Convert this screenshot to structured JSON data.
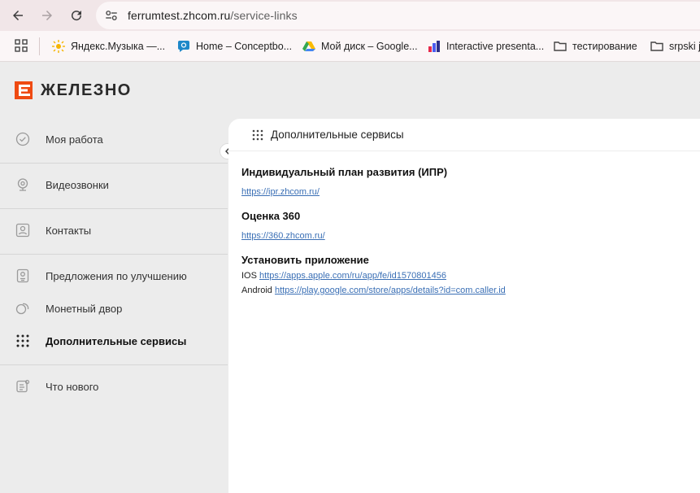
{
  "browser": {
    "url_host": "ferrumtest.zhcom.ru",
    "url_path": "/service-links",
    "bookmarks": [
      {
        "label": "Яндекс.Музыка —..."
      },
      {
        "label": "Home – Conceptbo..."
      },
      {
        "label": "Мой диск – Google..."
      },
      {
        "label": "Interactive presenta..."
      },
      {
        "label": "тестирование"
      },
      {
        "label": "srpski j"
      }
    ]
  },
  "app": {
    "logo_text": "ЖЕЛЕЗНО",
    "brand_color": "#ef4a12",
    "sidebar": {
      "items": [
        {
          "label": "Моя работа",
          "icon": "check-circle-icon"
        },
        {
          "label": "Видеозвонки",
          "icon": "webcam-icon"
        },
        {
          "label": "Контакты",
          "icon": "contact-card-icon"
        },
        {
          "label": "Предложения по улучшению",
          "icon": "suggestion-icon"
        },
        {
          "label": "Монетный двор",
          "icon": "coins-icon"
        },
        {
          "label": "Дополнительные сервисы",
          "icon": "grid-dots-icon",
          "active": true
        },
        {
          "label": "Что нового",
          "icon": "news-icon"
        }
      ]
    },
    "panel": {
      "title": "Дополнительные сервисы",
      "sections": [
        {
          "title": "Индивидуальный план развития (ИПР)",
          "link": "https://ipr.zhcom.ru/"
        },
        {
          "title": "Оценка 360",
          "link": "https://360.zhcom.ru/"
        },
        {
          "title": "Установить приложение"
        }
      ],
      "apps": {
        "ios_label": "IOS",
        "ios_link": "https://apps.apple.com/ru/app/fe/id1570801456",
        "android_label": "Android",
        "android_link": "https://play.google.com/store/apps/details?id=com.caller.id"
      }
    }
  }
}
